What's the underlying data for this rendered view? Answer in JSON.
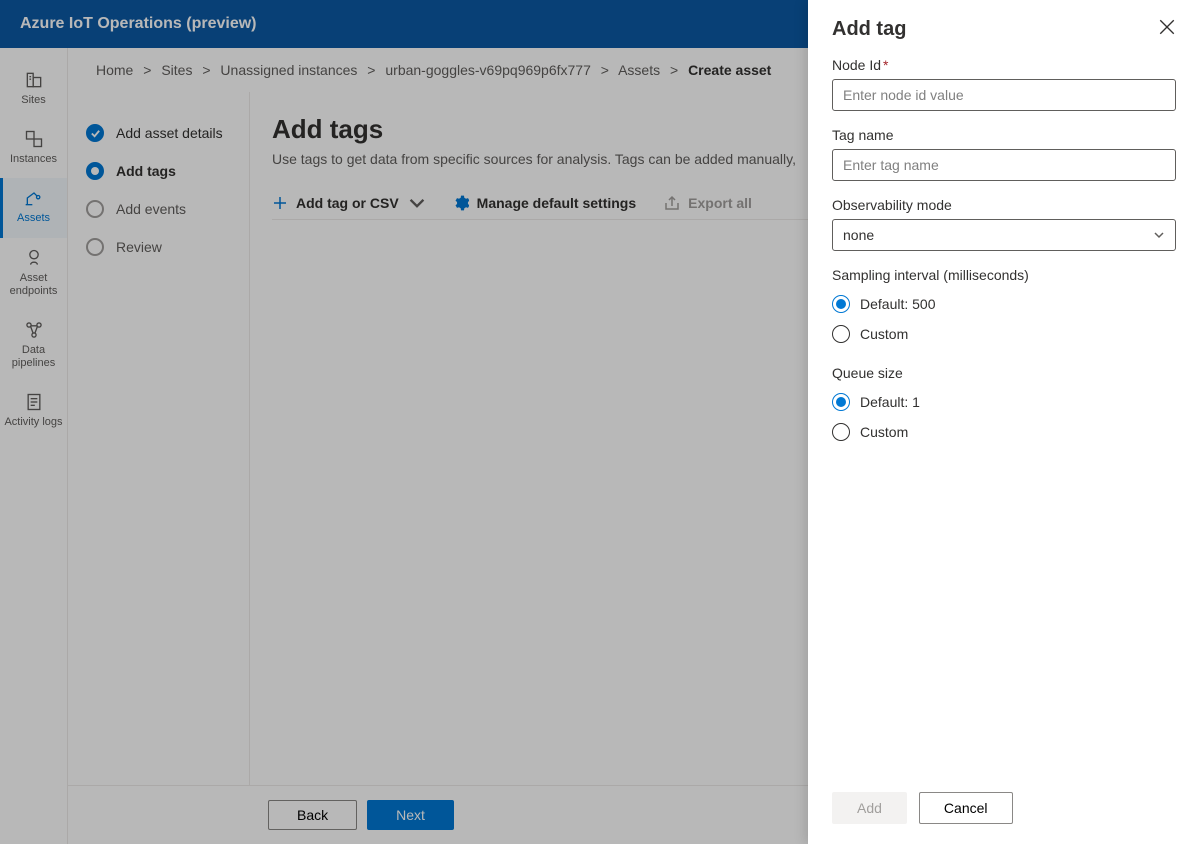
{
  "topbar": {
    "title": "Azure IoT Operations (preview)"
  },
  "rail": {
    "items": [
      {
        "label": "Sites",
        "active": false
      },
      {
        "label": "Instances",
        "active": false
      },
      {
        "label": "Assets",
        "active": true
      },
      {
        "label": "Asset endpoints",
        "active": false
      },
      {
        "label": "Data pipelines",
        "active": false
      },
      {
        "label": "Activity logs",
        "active": false
      }
    ]
  },
  "breadcrumb": {
    "items": [
      "Home",
      "Sites",
      "Unassigned instances",
      "urban-goggles-v69pq969p6fx777",
      "Assets"
    ],
    "current": "Create asset"
  },
  "steps": {
    "items": [
      {
        "label": "Add asset details",
        "state": "completed"
      },
      {
        "label": "Add tags",
        "state": "current"
      },
      {
        "label": "Add events",
        "state": "pending"
      },
      {
        "label": "Review",
        "state": "pending"
      }
    ]
  },
  "page": {
    "title": "Add tags",
    "desc": "Use tags to get data from specific sources for analysis. Tags can be added manually,"
  },
  "toolbar": {
    "add_label": "Add tag or CSV",
    "manage_label": "Manage default settings",
    "export_label": "Export all"
  },
  "footer": {
    "back_label": "Back",
    "next_label": "Next"
  },
  "panel": {
    "title": "Add tag",
    "node_id_label": "Node Id",
    "node_id_placeholder": "Enter node id value",
    "tag_name_label": "Tag name",
    "tag_name_placeholder": "Enter tag name",
    "observability_label": "Observability mode",
    "observability_value": "none",
    "sampling_label": "Sampling interval (milliseconds)",
    "sampling_default_label": "Default: 500",
    "sampling_custom_label": "Custom",
    "queue_label": "Queue size",
    "queue_default_label": "Default: 1",
    "queue_custom_label": "Custom",
    "add_button": "Add",
    "cancel_button": "Cancel"
  }
}
